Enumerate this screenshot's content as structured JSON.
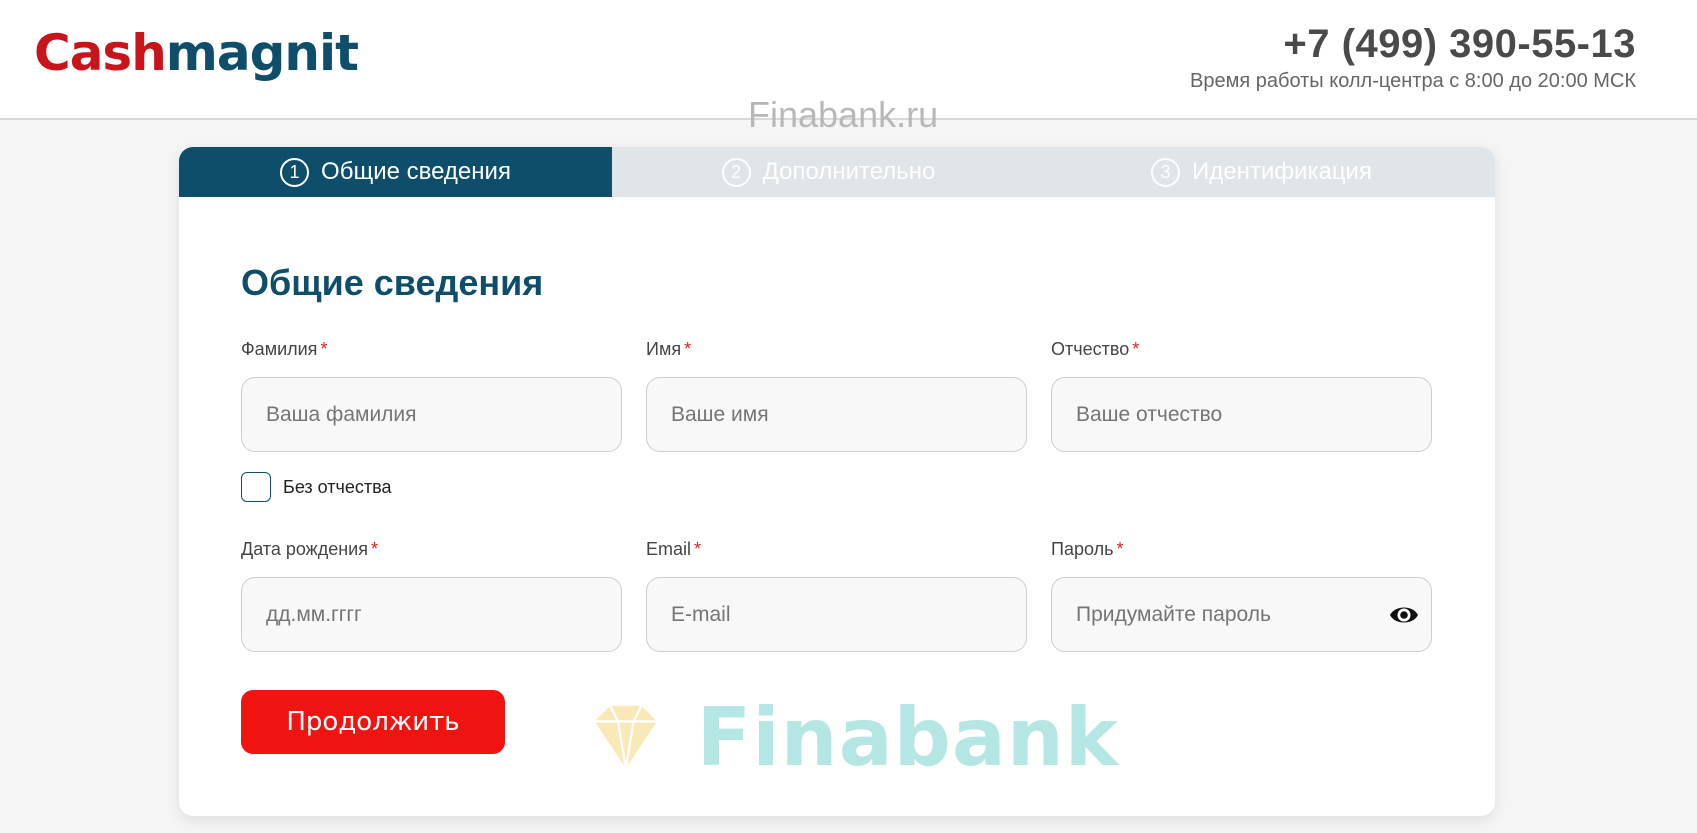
{
  "header": {
    "logo_part1": "Cash",
    "logo_part2": "magnit",
    "phone": "+7 (499) 390-55-13",
    "hours": "Время работы колл-центра с 8:00 до 20:00 МСК",
    "watermark": "Finabank.ru"
  },
  "steps": [
    {
      "number": "1",
      "label": "Общие сведения",
      "active": true
    },
    {
      "number": "2",
      "label": "Дополнительно",
      "active": false
    },
    {
      "number": "3",
      "label": "Идентификация",
      "active": false
    }
  ],
  "form": {
    "title": "Общие сведения",
    "required_mark": "*",
    "fields": {
      "last_name": {
        "label": "Фамилия",
        "placeholder": "Ваша фамилия"
      },
      "first_name": {
        "label": "Имя",
        "placeholder": "Ваше имя"
      },
      "patronymic": {
        "label": "Отчество",
        "placeholder": "Ваше отчество"
      },
      "birth_date": {
        "label": "Дата рождения",
        "placeholder": "дд.мм.гггг"
      },
      "email": {
        "label": "Email",
        "placeholder": "E-mail"
      },
      "password": {
        "label": "Пароль",
        "placeholder": "Придумайте пароль"
      }
    },
    "no_patronymic_label": "Без отчества",
    "continue_label": "Продолжить"
  },
  "watermark_bottom": "Finabank",
  "colors": {
    "brand_red": "#c8141b",
    "brand_blue": "#0e4e6b",
    "button_red": "#f01410",
    "required_red": "#e01e1e",
    "inactive_tab": "#dfe5e8"
  }
}
